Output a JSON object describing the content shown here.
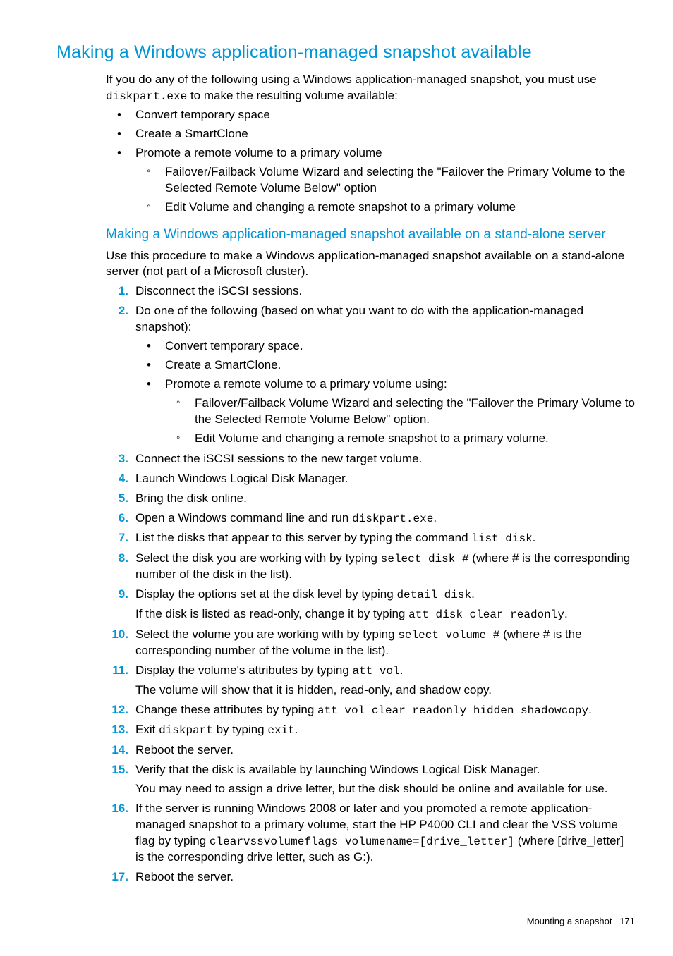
{
  "title": "Making a Windows application-managed snapshot available",
  "intro_before": "If you do any of the following using a Windows application-managed snapshot, you must use ",
  "intro_code": "diskpart.exe",
  "intro_after": " to make the resulting volume available:",
  "top_bullets": [
    "Convert temporary space",
    "Create a SmartClone",
    "Promote a remote volume to a primary volume"
  ],
  "top_sub": [
    "Failover/Failback Volume Wizard and selecting the \"Failover the Primary Volume to the Selected Remote Volume Below\" option",
    "Edit Volume and changing a remote snapshot to a primary volume"
  ],
  "h2": "Making a Windows application-managed snapshot available on a stand-alone server",
  "h2_intro": "Use this procedure to make a Windows application-managed snapshot available on a stand-alone server (not part of a Microsoft cluster).",
  "steps": {
    "s1": "Disconnect the iSCSI sessions.",
    "s2": "Do one of the following (based on what you want to do with the application-managed snapshot):",
    "s2_bullets": [
      "Convert temporary space.",
      "Create a SmartClone.",
      "Promote a remote volume to a primary volume using:"
    ],
    "s2_sub": [
      "Failover/Failback Volume Wizard and selecting the \"Failover the Primary Volume to the Selected Remote Volume Below\" option.",
      "Edit Volume and changing a remote snapshot to a primary volume."
    ],
    "s3": "Connect the iSCSI sessions to the new target volume.",
    "s4": "Launch Windows Logical Disk Manager.",
    "s5": "Bring the disk online.",
    "s6a": "Open a Windows command line and run ",
    "s6c": "diskpart.exe",
    "s6b": ".",
    "s7a": "List the disks that appear to this server by typing the command ",
    "s7c": "list disk",
    "s7b": ".",
    "s8a": "Select the disk you are working with by typing ",
    "s8c": "select disk #",
    "s8b": " (where # is the corresponding number of the disk in the list).",
    "s9a": "Display the options set at the disk level by typing ",
    "s9c": "detail disk",
    "s9b": ".",
    "s9xa": "If the disk is listed as read-only, change it by typing ",
    "s9xc": "att disk clear readonly",
    "s9xb": ".",
    "s10a": "Select the volume you are working with by typing ",
    "s10c": "select volume #",
    "s10b": " (where # is the corresponding number of the volume in the list).",
    "s11a": "Display the volume's attributes by typing ",
    "s11c": "att vol",
    "s11b": ".",
    "s11x": "The volume will show that it is hidden, read-only, and shadow copy.",
    "s12a": "Change these attributes by typing ",
    "s12c": "att vol clear readonly hidden shadowcopy",
    "s12b": ".",
    "s13a": "Exit ",
    "s13c": "diskpart",
    "s13m": " by typing ",
    "s13c2": "exit",
    "s13b": ".",
    "s14": "Reboot the server.",
    "s15": "Verify that the disk is available by launching Windows Logical Disk Manager.",
    "s15x": "You may need to assign a drive letter, but the disk should be online and available for use.",
    "s16a": "If the server is running Windows 2008 or later and you promoted a remote application-managed snapshot to a primary volume, start the HP P4000 CLI and clear the VSS volume flag by typing ",
    "s16c": "clearvssvolumeflags volumename=[drive_letter]",
    "s16b": " (where [drive_letter] is the corresponding drive letter, such as G:).",
    "s17": "Reboot the server."
  },
  "footer_label": "Mounting a snapshot",
  "footer_page": "171"
}
